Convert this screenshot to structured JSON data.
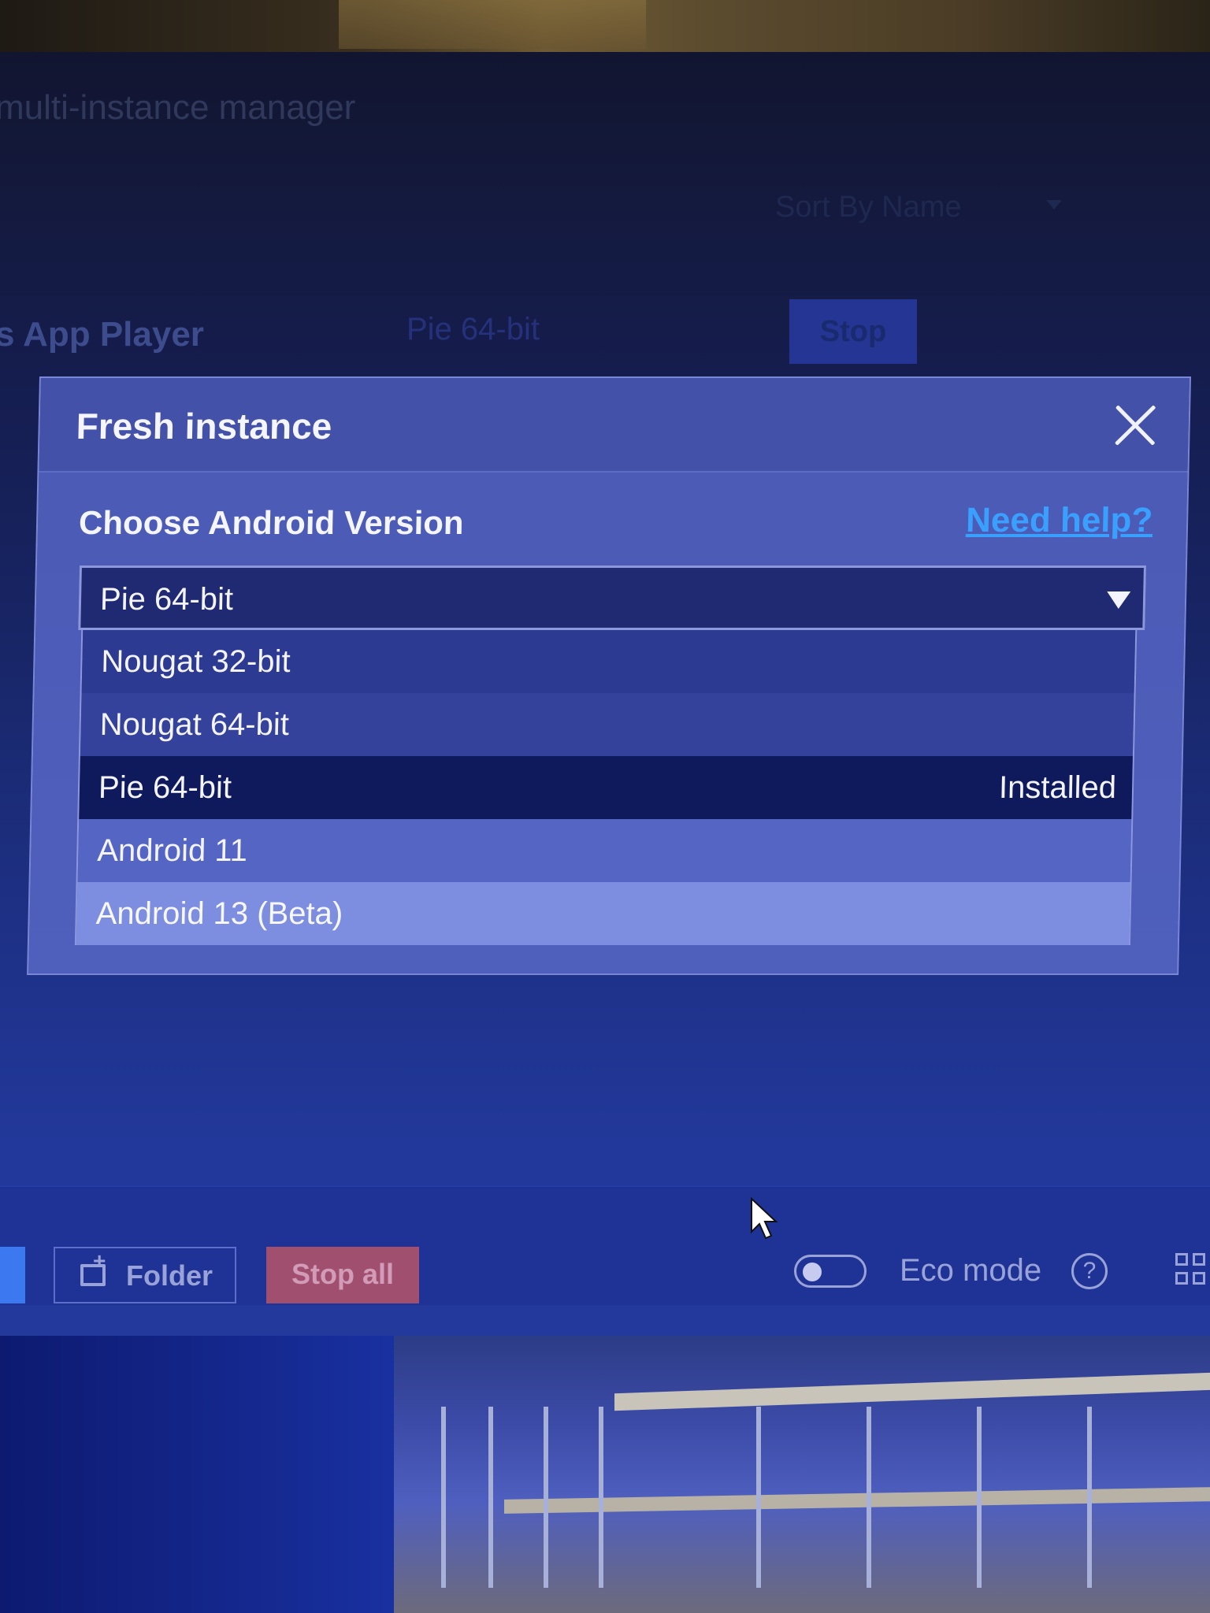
{
  "background": {
    "window_title": "multi-instance manager",
    "sort_label": "Sort By Name",
    "instance_name": "s App Player",
    "instance_version": "Pie 64-bit",
    "stop_label": "Stop"
  },
  "dialog": {
    "title": "Fresh instance",
    "section_label": "Choose Android Version",
    "help_link": "Need help?",
    "selected_value": "Pie 64-bit",
    "options": [
      {
        "label": "Nougat 32-bit",
        "status": ""
      },
      {
        "label": "Nougat 64-bit",
        "status": ""
      },
      {
        "label": "Pie 64-bit",
        "status": "Installed"
      },
      {
        "label": "Android 11",
        "status": ""
      },
      {
        "label": "Android 13 (Beta)",
        "status": ""
      }
    ]
  },
  "toolbar": {
    "folder_label": "Folder",
    "stop_all_label": "Stop all",
    "eco_mode_label": "Eco mode",
    "help_glyph": "?"
  },
  "colors": {
    "dialog_bg": "#4b5ab4",
    "selected_option": "#0f1a5c",
    "hover_option": "#7d8ee0",
    "link": "#3aa0ff",
    "stop_all": "#a0506e"
  },
  "icons": {
    "close": "close-icon",
    "dropdown": "chevron-down-icon",
    "folder": "folder-add-icon",
    "help": "help-circle-icon",
    "grid": "grid-layout-icon",
    "cursor": "mouse-pointer-icon"
  }
}
